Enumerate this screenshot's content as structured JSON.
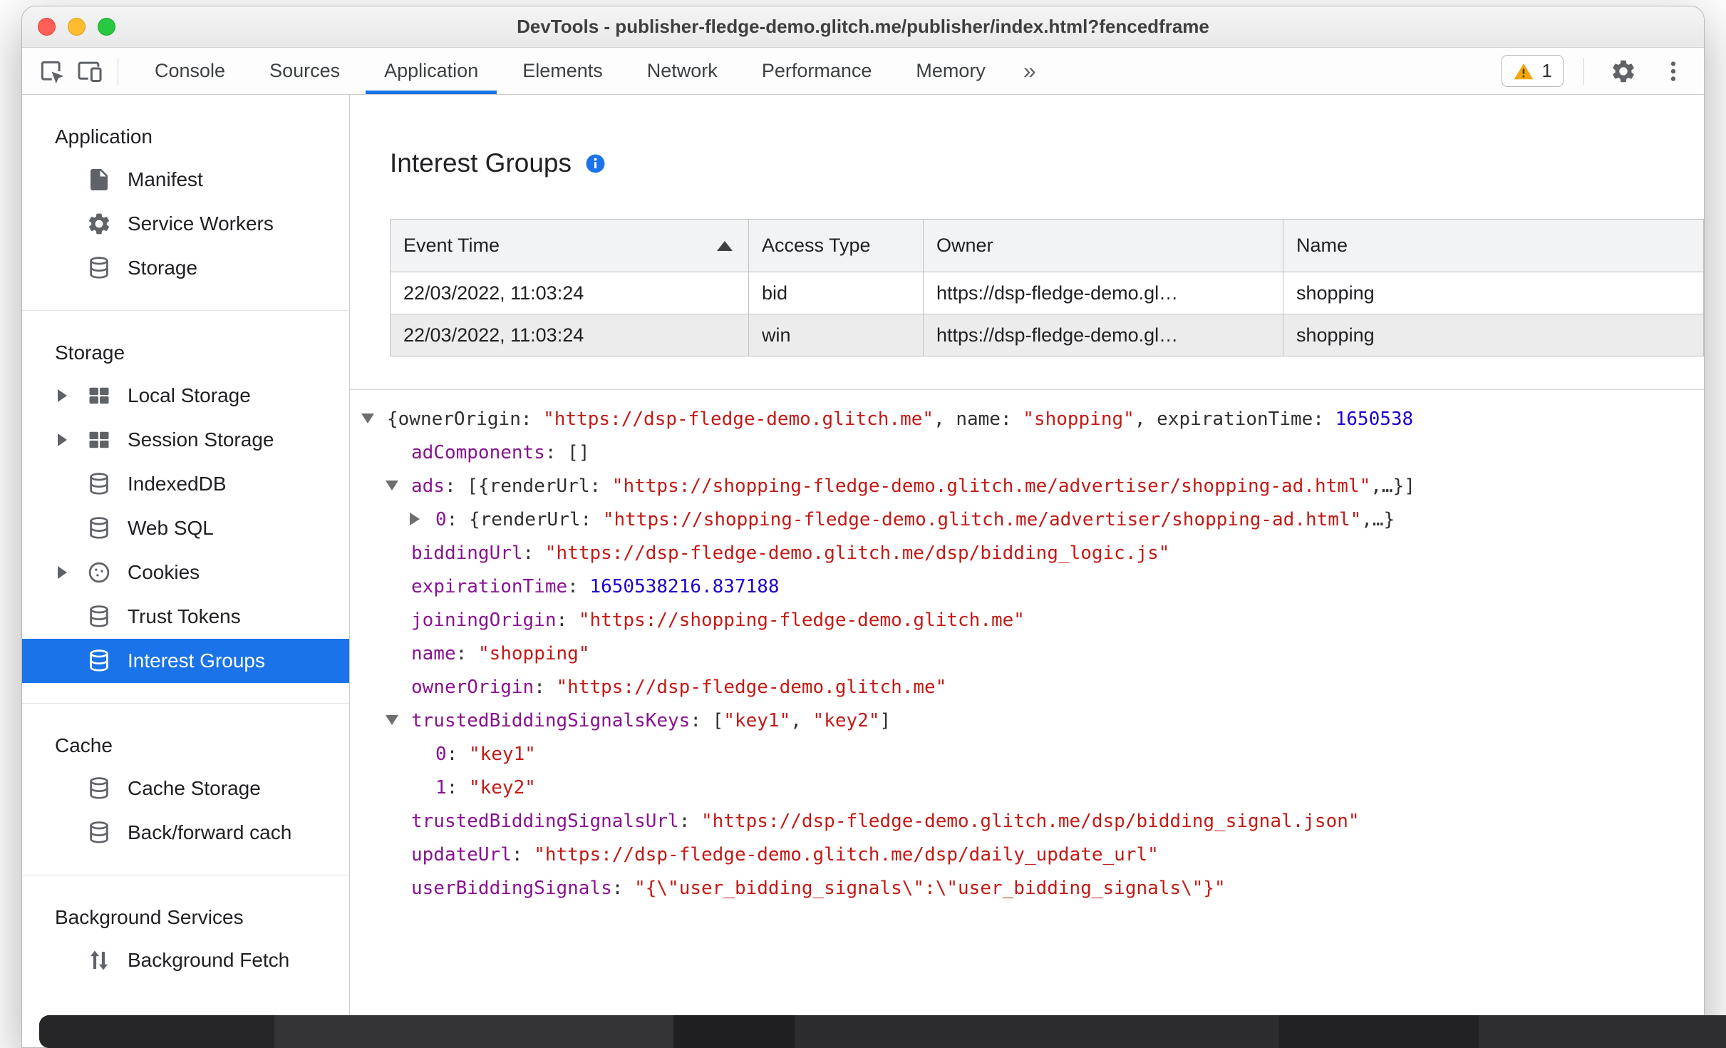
{
  "window": {
    "title": "DevTools - publisher-fledge-demo.glitch.me/publisher/index.html?fencedframe"
  },
  "toolbar": {
    "tabs": [
      {
        "label": "Console",
        "active": false
      },
      {
        "label": "Sources",
        "active": false
      },
      {
        "label": "Application",
        "active": true
      },
      {
        "label": "Elements",
        "active": false
      },
      {
        "label": "Network",
        "active": false
      },
      {
        "label": "Performance",
        "active": false
      },
      {
        "label": "Memory",
        "active": false
      }
    ],
    "more_tabs_label": "»",
    "issues": {
      "count": "1",
      "icon": "warning"
    },
    "icons": [
      "inspect",
      "device",
      "settings",
      "dots"
    ]
  },
  "sidebar": {
    "sections": [
      {
        "title": "Application",
        "items": [
          {
            "label": "Manifest",
            "icon": "document"
          },
          {
            "label": "Service Workers",
            "icon": "gear"
          },
          {
            "label": "Storage",
            "icon": "database"
          }
        ]
      },
      {
        "title": "Storage",
        "items": [
          {
            "label": "Local Storage",
            "icon": "table",
            "expandable": true
          },
          {
            "label": "Session Storage",
            "icon": "table",
            "expandable": true
          },
          {
            "label": "IndexedDB",
            "icon": "database"
          },
          {
            "label": "Web SQL",
            "icon": "database"
          },
          {
            "label": "Cookies",
            "icon": "cookie",
            "expandable": true
          },
          {
            "label": "Trust Tokens",
            "icon": "database"
          },
          {
            "label": "Interest Groups",
            "icon": "database",
            "selected": true
          }
        ]
      },
      {
        "title": "Cache",
        "items": [
          {
            "label": "Cache Storage",
            "icon": "database"
          },
          {
            "label": "Back/forward cach",
            "icon": "database"
          }
        ]
      },
      {
        "title": "Background Services",
        "items": [
          {
            "label": "Background Fetch",
            "icon": "fetch"
          }
        ]
      }
    ]
  },
  "main": {
    "title": "Interest Groups",
    "table": {
      "columns": [
        {
          "label": "Event Time",
          "sorted": true
        },
        {
          "label": "Access Type",
          "sorted": false
        },
        {
          "label": "Owner",
          "sorted": false
        },
        {
          "label": "Name",
          "sorted": false
        }
      ],
      "rows": [
        {
          "cells": [
            "22/03/2022, 11:03:24",
            "bid",
            "https://dsp-fledge-demo.gl…",
            "shopping"
          ],
          "selected": false
        },
        {
          "cells": [
            "22/03/2022, 11:03:24",
            "win",
            "https://dsp-fledge-demo.gl…",
            "shopping"
          ],
          "selected": true
        }
      ]
    },
    "tree": {
      "lines": [
        {
          "level": 0,
          "arrow": "expanded",
          "tokens": [
            {
              "c": "p",
              "t": "{"
            },
            {
              "c": "pk",
              "t": "ownerOrigin"
            },
            {
              "c": "p",
              "t": ": "
            },
            {
              "c": "s",
              "t": "\"https://dsp-fledge-demo.glitch.me\""
            },
            {
              "c": "p",
              "t": ", "
            },
            {
              "c": "pk",
              "t": "name"
            },
            {
              "c": "p",
              "t": ": "
            },
            {
              "c": "s",
              "t": "\"shopping\""
            },
            {
              "c": "p",
              "t": ", "
            },
            {
              "c": "pk",
              "t": "expirationTime"
            },
            {
              "c": "p",
              "t": ": "
            },
            {
              "c": "n",
              "t": "1650538"
            }
          ]
        },
        {
          "level": 1,
          "arrow": "none",
          "tokens": [
            {
              "c": "k",
              "t": "adComponents"
            },
            {
              "c": "p",
              "t": ": "
            },
            {
              "c": "p",
              "t": "[]"
            }
          ]
        },
        {
          "level": 1,
          "arrow": "expanded",
          "tokens": [
            {
              "c": "k",
              "t": "ads"
            },
            {
              "c": "p",
              "t": ": "
            },
            {
              "c": "p",
              "t": "[{"
            },
            {
              "c": "pk",
              "t": "renderUrl"
            },
            {
              "c": "p",
              "t": ": "
            },
            {
              "c": "s",
              "t": "\"https://shopping-fledge-demo.glitch.me/advertiser/shopping-ad.html\""
            },
            {
              "c": "p",
              "t": ",…}]"
            }
          ]
        },
        {
          "level": 2,
          "arrow": "collapsed",
          "tokens": [
            {
              "c": "k",
              "t": "0"
            },
            {
              "c": "p",
              "t": ": "
            },
            {
              "c": "p",
              "t": "{"
            },
            {
              "c": "pk",
              "t": "renderUrl"
            },
            {
              "c": "p",
              "t": ": "
            },
            {
              "c": "s",
              "t": "\"https://shopping-fledge-demo.glitch.me/advertiser/shopping-ad.html\""
            },
            {
              "c": "p",
              "t": ",…}"
            }
          ]
        },
        {
          "level": 1,
          "arrow": "none",
          "tokens": [
            {
              "c": "k",
              "t": "biddingUrl"
            },
            {
              "c": "p",
              "t": ": "
            },
            {
              "c": "s",
              "t": "\"https://dsp-fledge-demo.glitch.me/dsp/bidding_logic.js\""
            }
          ]
        },
        {
          "level": 1,
          "arrow": "none",
          "tokens": [
            {
              "c": "k",
              "t": "expirationTime"
            },
            {
              "c": "p",
              "t": ": "
            },
            {
              "c": "n",
              "t": "1650538216.837188"
            }
          ]
        },
        {
          "level": 1,
          "arrow": "none",
          "tokens": [
            {
              "c": "k",
              "t": "joiningOrigin"
            },
            {
              "c": "p",
              "t": ": "
            },
            {
              "c": "s",
              "t": "\"https://shopping-fledge-demo.glitch.me\""
            }
          ]
        },
        {
          "level": 1,
          "arrow": "none",
          "tokens": [
            {
              "c": "k",
              "t": "name"
            },
            {
              "c": "p",
              "t": ": "
            },
            {
              "c": "s",
              "t": "\"shopping\""
            }
          ]
        },
        {
          "level": 1,
          "arrow": "none",
          "tokens": [
            {
              "c": "k",
              "t": "ownerOrigin"
            },
            {
              "c": "p",
              "t": ": "
            },
            {
              "c": "s",
              "t": "\"https://dsp-fledge-demo.glitch.me\""
            }
          ]
        },
        {
          "level": 1,
          "arrow": "expanded",
          "tokens": [
            {
              "c": "k",
              "t": "trustedBiddingSignalsKeys"
            },
            {
              "c": "p",
              "t": ": "
            },
            {
              "c": "p",
              "t": "["
            },
            {
              "c": "s",
              "t": "\"key1\""
            },
            {
              "c": "p",
              "t": ", "
            },
            {
              "c": "s",
              "t": "\"key2\""
            },
            {
              "c": "p",
              "t": "]"
            }
          ]
        },
        {
          "level": 2,
          "arrow": "none",
          "tokens": [
            {
              "c": "k",
              "t": "0"
            },
            {
              "c": "p",
              "t": ": "
            },
            {
              "c": "s",
              "t": "\"key1\""
            }
          ]
        },
        {
          "level": 2,
          "arrow": "none",
          "tokens": [
            {
              "c": "k",
              "t": "1"
            },
            {
              "c": "p",
              "t": ": "
            },
            {
              "c": "s",
              "t": "\"key2\""
            }
          ]
        },
        {
          "level": 1,
          "arrow": "none",
          "tokens": [
            {
              "c": "k",
              "t": "trustedBiddingSignalsUrl"
            },
            {
              "c": "p",
              "t": ": "
            },
            {
              "c": "s",
              "t": "\"https://dsp-fledge-demo.glitch.me/dsp/bidding_signal.json\""
            }
          ]
        },
        {
          "level": 1,
          "arrow": "none",
          "tokens": [
            {
              "c": "k",
              "t": "updateUrl"
            },
            {
              "c": "p",
              "t": ": "
            },
            {
              "c": "s",
              "t": "\"https://dsp-fledge-demo.glitch.me/dsp/daily_update_url\""
            }
          ]
        },
        {
          "level": 1,
          "arrow": "none",
          "tokens": [
            {
              "c": "k",
              "t": "userBiddingSignals"
            },
            {
              "c": "p",
              "t": ": "
            },
            {
              "c": "s",
              "t": "\"{\\\"user_bidding_signals\\\":\\\"user_bidding_signals\\\"}\""
            }
          ]
        }
      ]
    }
  }
}
